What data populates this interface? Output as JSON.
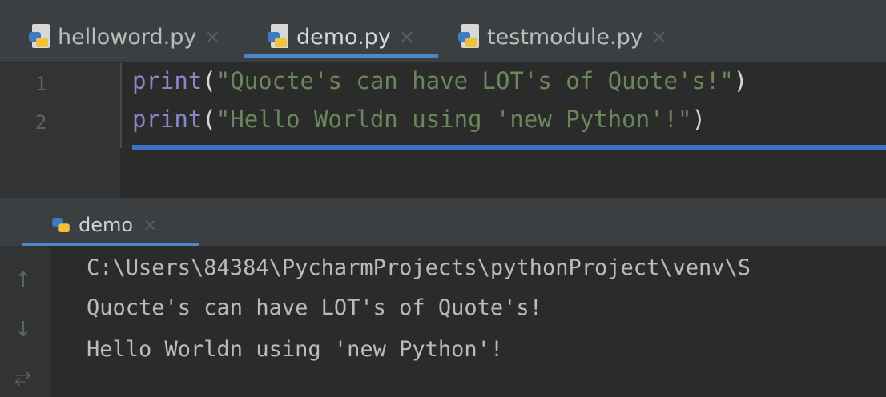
{
  "editor_tabs": [
    {
      "label": "helloword.py",
      "active": false
    },
    {
      "label": "demo.py",
      "active": true
    },
    {
      "label": "testmodule.py",
      "active": false
    }
  ],
  "tab_close_glyph": "×",
  "code": {
    "lines": [
      {
        "number": "1",
        "keyword": "print",
        "open": "(",
        "string": "\"Quocte's can have LOT's of Quote's!\"",
        "close": ")"
      },
      {
        "number": "2",
        "keyword": "print",
        "open": "(",
        "string": "\"Hello Worldn using 'new Python'!\"",
        "close": ")"
      }
    ]
  },
  "run_window": {
    "tab_label": "demo",
    "output": [
      "C:\\Users\\84384\\PycharmProjects\\pythonProject\\venv\\S",
      "Quocte's can have LOT's of Quote's!",
      "Hello Worldn using 'new Python'!"
    ],
    "gutter_icons": [
      "up-arrow-icon",
      "down-arrow-icon",
      "soft-wrap-icon"
    ]
  },
  "colors": {
    "keyword": "#8888c6",
    "string": "#6a8759",
    "accent": "#4a88c7",
    "background": "#2b2b2b"
  }
}
